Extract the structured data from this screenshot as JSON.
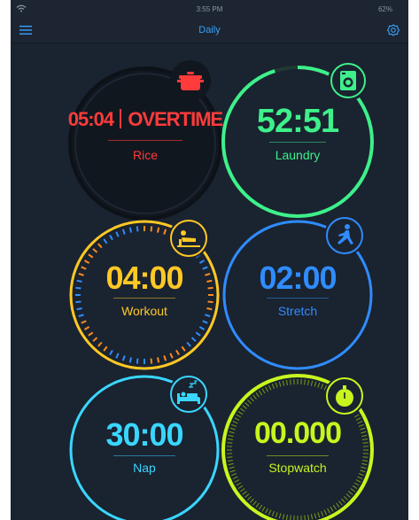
{
  "status": {
    "time": "3:55 PM",
    "battery": "62%"
  },
  "nav": {
    "title": "Daily"
  },
  "colors": {
    "background": "#1a2330",
    "rice": "#ff3b3b",
    "laundry": "#3ef08a",
    "workout": "#ffc825",
    "stretch": "#2f8cff",
    "nap": "#39d6ff",
    "stopwatch": "#c8f51e"
  },
  "timers": {
    "rice": {
      "time": "05:04",
      "status": "OVERTIME",
      "label": "Rice",
      "icon": "pot-icon"
    },
    "laundry": {
      "time": "52:51",
      "label": "Laundry",
      "icon": "washing-machine-icon",
      "progress": 0.95
    },
    "workout": {
      "time": "04:00",
      "label": "Workout",
      "icon": "pushup-icon"
    },
    "stretch": {
      "time": "02:00",
      "label": "Stretch",
      "icon": "stretch-icon"
    },
    "nap": {
      "time": "30:00",
      "label": "Nap",
      "icon": "bed-icon"
    },
    "stopwatch": {
      "time": "00.000",
      "label": "Stopwatch",
      "icon": "stopwatch-icon"
    }
  }
}
